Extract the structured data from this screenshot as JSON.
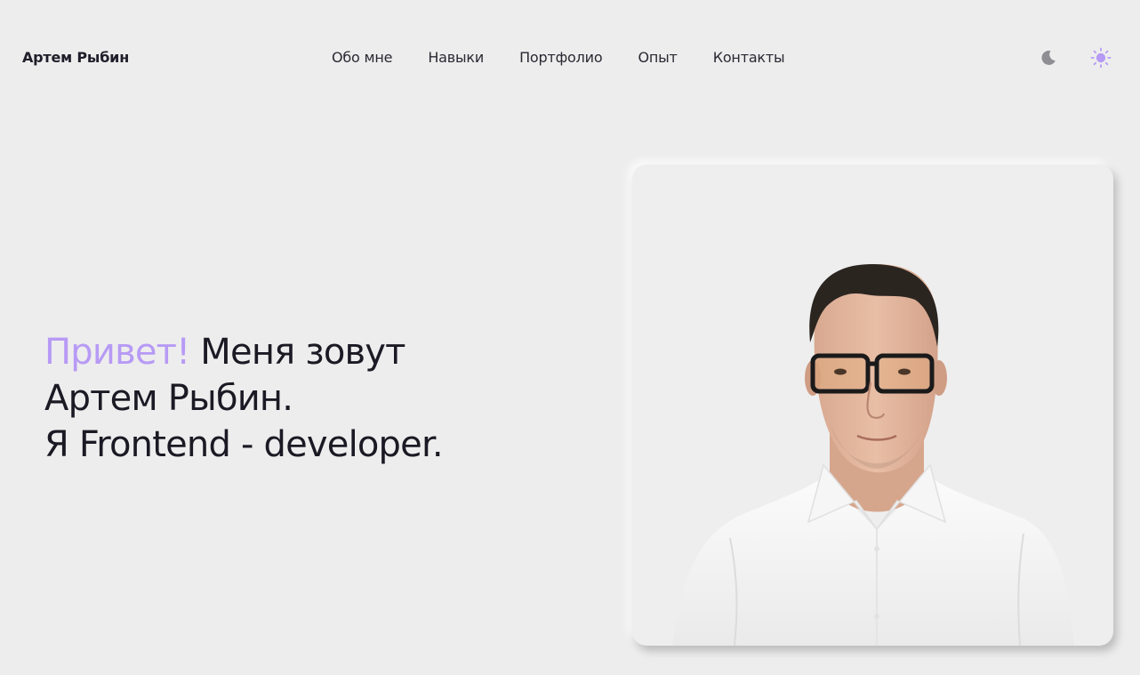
{
  "header": {
    "logo": "Артем Рыбин",
    "nav": [
      {
        "label": "Обо мне"
      },
      {
        "label": "Навыки"
      },
      {
        "label": "Портфолио"
      },
      {
        "label": "Опыт"
      },
      {
        "label": "Контакты"
      }
    ],
    "theme_toggle": {
      "dark_icon": "moon-icon",
      "light_icon": "sun-icon",
      "active": "light"
    }
  },
  "hero": {
    "greeting": "Привет!",
    "line1_rest": " Меня зовут",
    "line2": "Артем Рыбин.",
    "line3": "Я Frontend - developer."
  },
  "photo": {
    "subject": "portrait-photo"
  },
  "colors": {
    "background": "#ededed",
    "accent": "#b79af5",
    "text": "#1b1a24",
    "icon_inactive": "#8e8e93"
  }
}
